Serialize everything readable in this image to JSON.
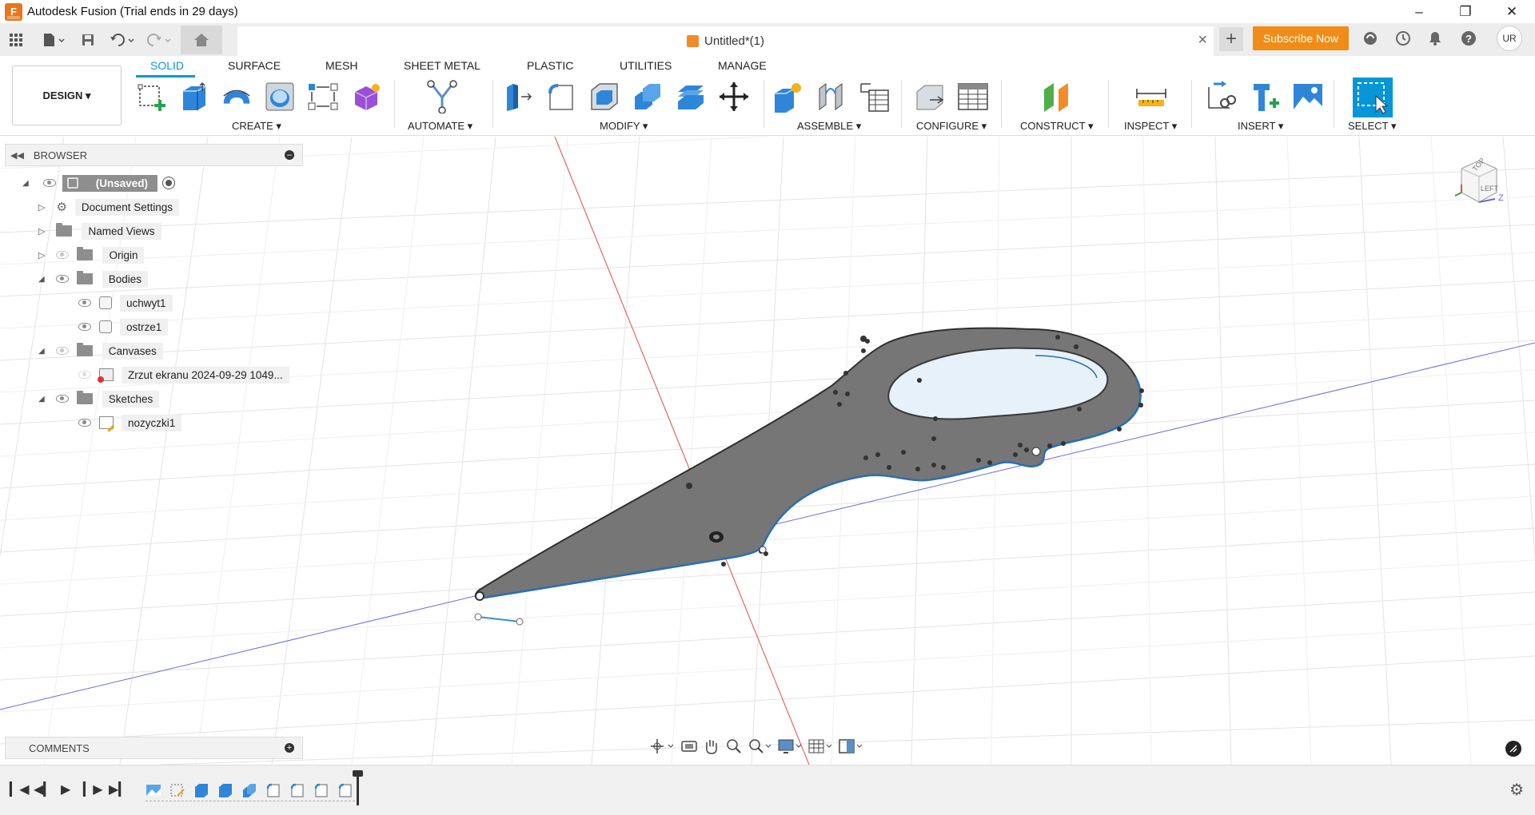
{
  "window": {
    "title": "Autodesk Fusion (Trial ends in 29 days)",
    "logo_letter": "F"
  },
  "doc": {
    "tab_title": "Untitled*(1)"
  },
  "header": {
    "subscribe_label": "Subscribe Now",
    "avatar_initials": "UR"
  },
  "workspace": {
    "label": "DESIGN ▾"
  },
  "tabs": [
    "SOLID",
    "SURFACE",
    "MESH",
    "SHEET METAL",
    "PLASTIC",
    "UTILITIES",
    "MANAGE"
  ],
  "groups": [
    "CREATE ▾",
    "AUTOMATE ▾",
    "MODIFY ▾",
    "ASSEMBLE ▾",
    "CONFIGURE ▾",
    "CONSTRUCT ▾",
    "INSPECT ▾",
    "INSERT ▾",
    "SELECT ▾"
  ],
  "browser": {
    "title": "BROWSER",
    "root": "(Unsaved)",
    "items": [
      "Document Settings",
      "Named Views",
      "Origin",
      "Bodies",
      "uchwyt1",
      "ostrze1",
      "Canvases",
      "Zrzut ekranu 2024-09-29 1049...",
      "Sketches",
      "nozyczki1"
    ]
  },
  "comments": {
    "title": "COMMENTS"
  },
  "viewcube": {
    "top": "TOP",
    "left": "LEFT",
    "z": "Z"
  },
  "colors": {
    "accent": "#0696d7",
    "subscribe": "#f08c18",
    "body_fill": "#707070",
    "edge": "#2a6fb5"
  }
}
